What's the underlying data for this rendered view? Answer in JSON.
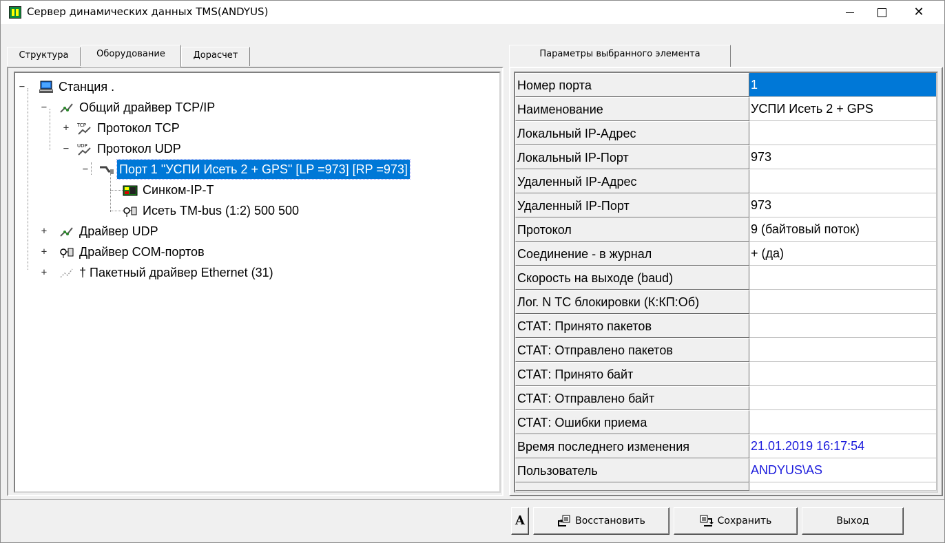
{
  "window": {
    "title": "Сервер динамических данных TMS(ANDYUS)",
    "icon": "app-icon",
    "controls": [
      "minimize-icon",
      "maximize-icon",
      "close-icon"
    ]
  },
  "left_tabs": [
    {
      "label": "Структура",
      "active": false
    },
    {
      "label": "Оборудование",
      "active": true
    },
    {
      "label": "Дорасчет",
      "active": false
    }
  ],
  "tree": {
    "nodes": [
      {
        "label": "Станция .",
        "icon": "computer-icon",
        "expander": "−"
      },
      {
        "label": "Общий драйвер TCP/IP",
        "icon": "network-driver-icon",
        "expander": "−"
      },
      {
        "label": "Протокол TCP",
        "icon": "tcp-protocol-icon",
        "expander": "+"
      },
      {
        "label": "Протокол UDP",
        "icon": "udp-protocol-icon",
        "expander": "−"
      },
      {
        "label": "Порт 1 \"УСПИ Исеть 2 + GPS\" [LP =973] [RP =973]",
        "icon": "port-icon",
        "expander": "−",
        "selected": true
      },
      {
        "label": "Синком-IP-T",
        "icon": "board-icon"
      },
      {
        "label": "Исеть TM-bus  (1:2) 500 500",
        "icon": "device-link-icon"
      },
      {
        "label": "Драйвер UDP",
        "icon": "network-driver-icon",
        "expander": "+"
      },
      {
        "label": "Драйвер COM-портов",
        "icon": "com-driver-icon",
        "expander": "+"
      },
      {
        "label": "† Пакетный драйвер Ethernet  (31)",
        "icon": "packet-driver-icon",
        "expander": "+"
      }
    ]
  },
  "right_tab": {
    "label": "Параметры выбранного элемента"
  },
  "params": [
    {
      "key": "Номер порта",
      "value": "1",
      "selected": true
    },
    {
      "key": "Наименование",
      "value": "УСПИ Исеть 2 + GPS"
    },
    {
      "key": "Локальный IP-Адрес",
      "value": ""
    },
    {
      "key": "Локальный IP-Порт",
      "value": "973"
    },
    {
      "key": "Удаленный IP-Адрес",
      "value": ""
    },
    {
      "key": "Удаленный IP-Порт",
      "value": "973"
    },
    {
      "key": "Протокол",
      "value": "9 (байтовый поток)"
    },
    {
      "key": "Соединение - в журнал",
      "value": "+ (да)"
    },
    {
      "key": "Скорость на выходе (baud)",
      "value": ""
    },
    {
      "key": "Лог. N ТС блокировки (К:КП:Об)",
      "value": ""
    },
    {
      "key": "СТАТ: Принято пакетов",
      "value": ""
    },
    {
      "key": "СТАТ: Отправлено пакетов",
      "value": ""
    },
    {
      "key": "СТАТ: Принято байт",
      "value": ""
    },
    {
      "key": "СТАТ: Отправлено байт",
      "value": ""
    },
    {
      "key": "СТАТ: Ошибки приема",
      "value": ""
    },
    {
      "key": "Время последнего изменения",
      "value": "21.01.2019 16:17:54",
      "blue": true
    },
    {
      "key": "Пользователь",
      "value": "ANDYUS\\AS",
      "blue": true
    }
  ],
  "buttons": {
    "font": "A",
    "restore": "Восстановить",
    "save": "Сохранить",
    "exit": "Выход"
  },
  "colors": {
    "selection": "#0078d7",
    "link_blue": "#1a1adc",
    "face": "#f0f0f0"
  }
}
